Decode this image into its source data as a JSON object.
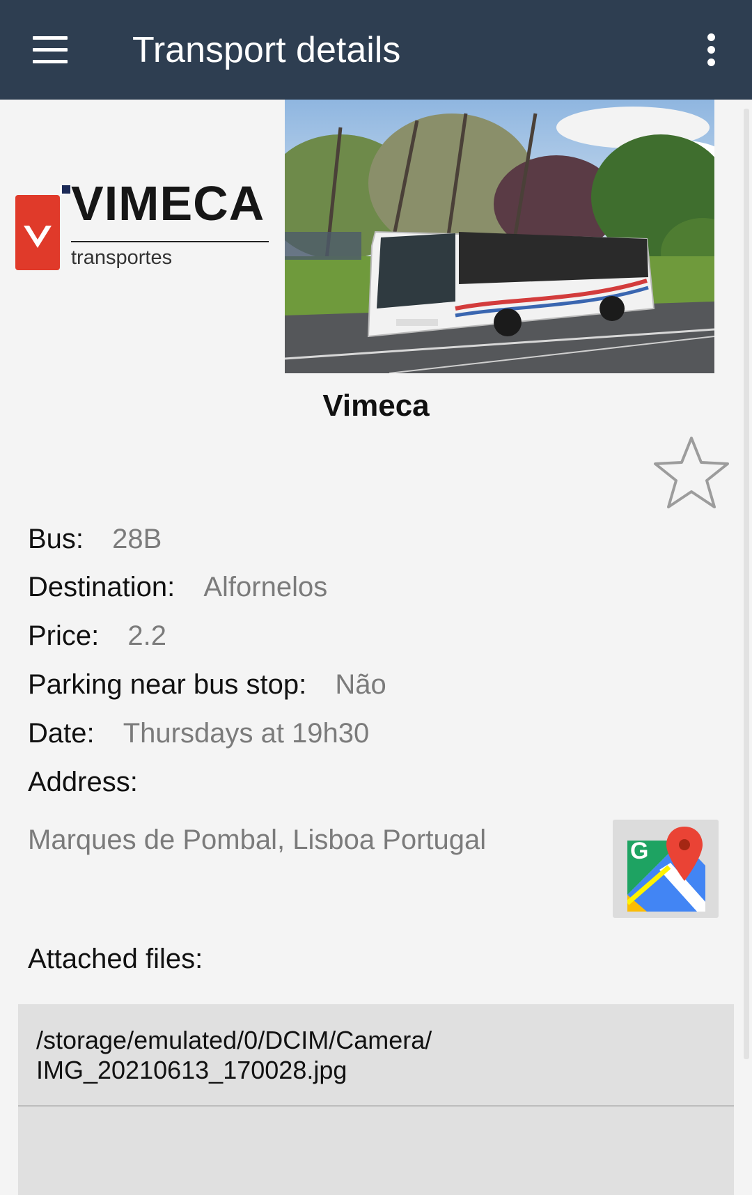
{
  "appbar": {
    "title": "Transport details",
    "menu_icon": "hamburger-menu-icon",
    "overflow_icon": "more-vert-icon",
    "background": "#2e3e51"
  },
  "company": {
    "logo_word": "VIMECA",
    "logo_sub": "transportes",
    "logo_colors": {
      "red": "#e03a2a",
      "navy": "#1c2a57"
    },
    "name": "Vimeca",
    "favorite_icon": "star-outline-icon",
    "photo": "photo-of-white-city-bus"
  },
  "details": {
    "bus_label": "Bus:",
    "bus_value": "28B",
    "destination_label": "Destination:",
    "destination_value": "Alfornelos",
    "price_label": "Price:",
    "price_value": "2.2",
    "parking_label": "Parking near bus stop:",
    "parking_value": "Não",
    "date_label": "Date:",
    "date_value": "Thursdays at 19h30",
    "address_label": "Address:",
    "address_value": "Marques de Pombal, Lisboa Portugal",
    "maps_icon": "google-maps-icon"
  },
  "files": {
    "label": "Attached files:",
    "items": [
      {
        "path_line1": "/storage/emulated/0/DCIM/Camera/",
        "path_line2": "IMG_20210613_170028.jpg"
      }
    ]
  }
}
